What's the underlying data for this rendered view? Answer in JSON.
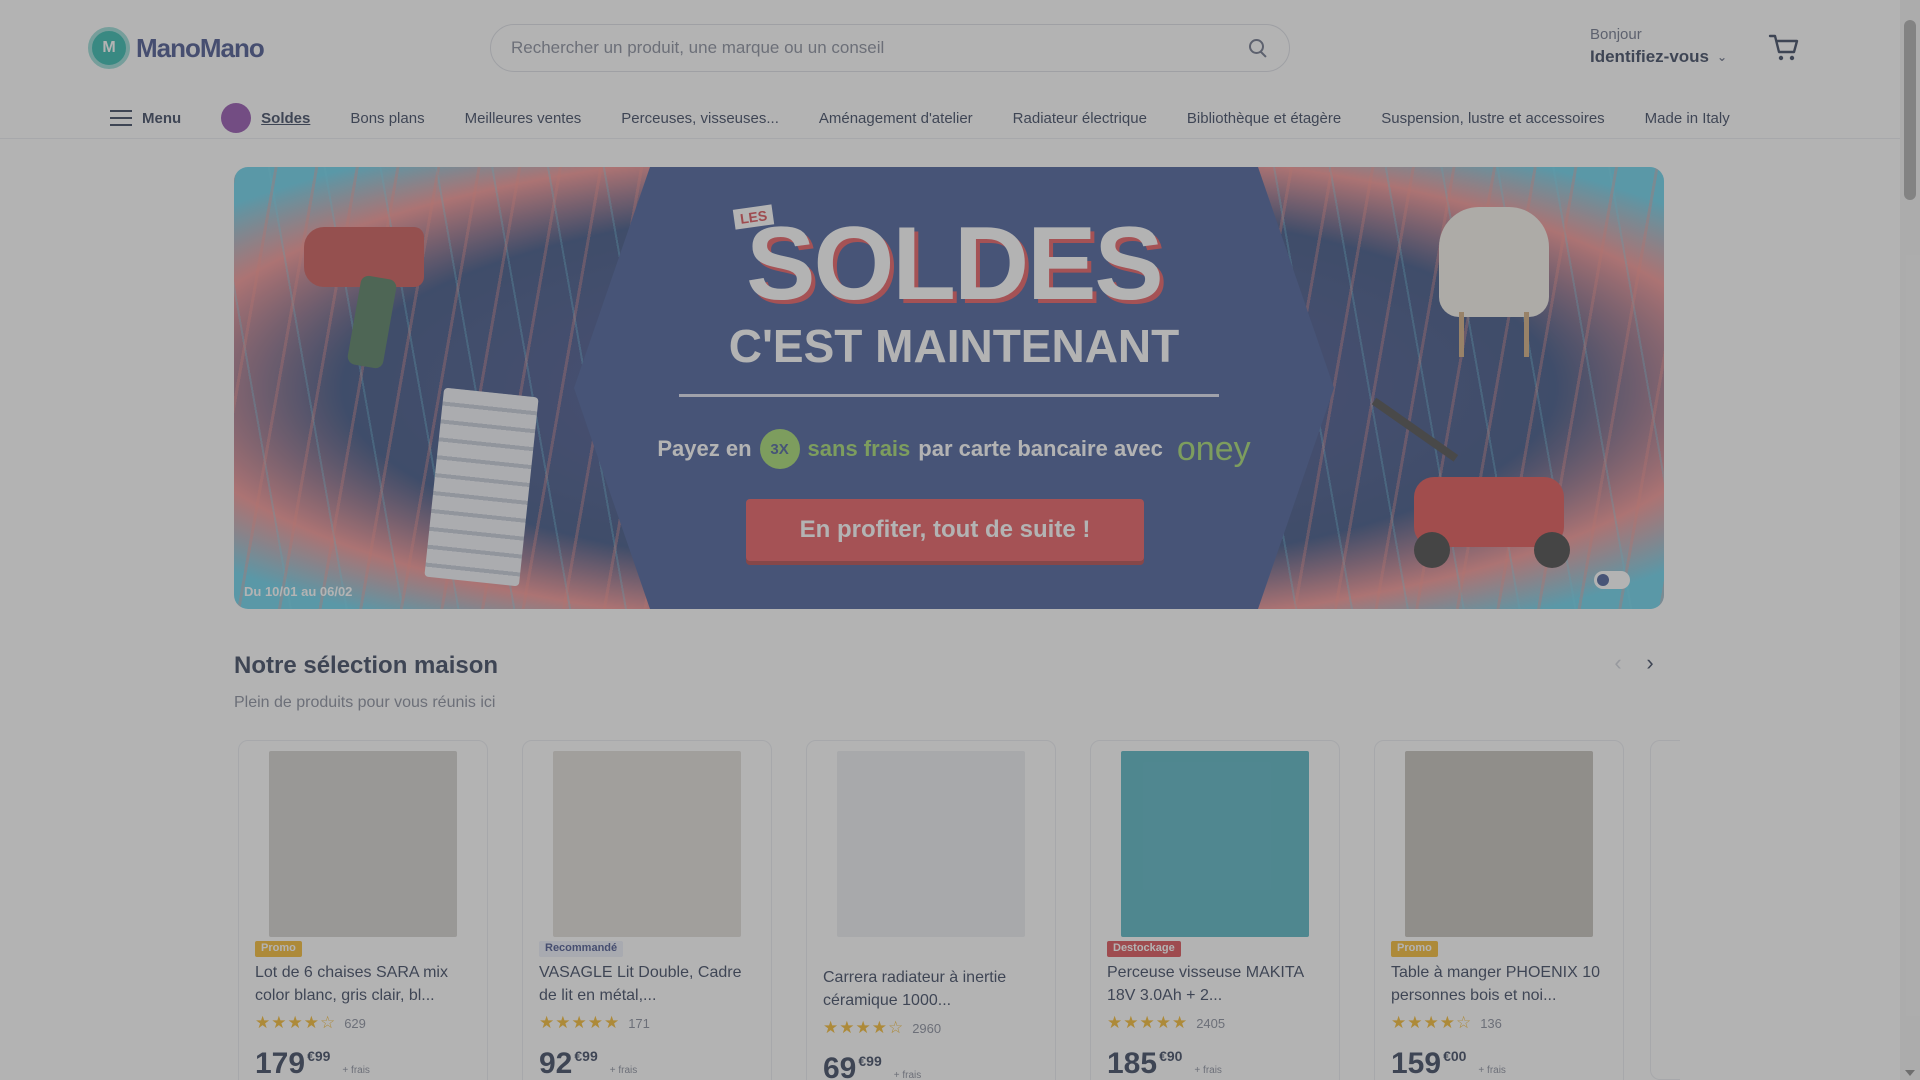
{
  "header": {
    "logo_mark": "M",
    "logo_text": "ManoMano",
    "search_placeholder": "Rechercher un produit, une marque ou un conseil",
    "account_greeting": "Bonjour",
    "account_login": "Identifiez-vous",
    "account_chevron": "⌄"
  },
  "nav": {
    "menu_label": "Menu",
    "soldes_label": "Soldes",
    "items": [
      "Bons plans",
      "Meilleures ventes",
      "Perceuses, visseuses...",
      "Aménagement d'atelier",
      "Radiateur électrique",
      "Bibliothèque et étagère",
      "Suspension, lustre et accessoires",
      "Made in Italy"
    ]
  },
  "hero": {
    "tag": "LES",
    "title": "SOLDES",
    "subtitle": "C'EST MAINTENANT",
    "pay_prefix": "Payez en",
    "pay_badge": "3X",
    "pay_green": "sans frais",
    "pay_suffix": "par carte bancaire avec",
    "pay_brand": "oney",
    "cta": "En profiter, tout de suite !",
    "dates": "Du 10/01 au 06/02"
  },
  "section": {
    "title": "Notre sélection maison",
    "subtitle": "Plein de produits pour vous réunis ici",
    "prev": "‹",
    "next": "›"
  },
  "products": [
    {
      "title": "Lot de 6 chaises SARA mix color blanc, gris clair, bl...",
      "badge": "Promo",
      "rating": "★★★★☆",
      "reviews": "629",
      "price_int": "179",
      "price_dec": "€99",
      "note": "+ frais",
      "image_color": "#c9c7c2"
    },
    {
      "title": "VASAGLE Lit Double, Cadre de lit en métal,...",
      "badge": "Recommandé",
      "rating": "★★★★★",
      "reviews": "171",
      "price_int": "92",
      "price_dec": "€99",
      "note": "+ frais",
      "image_color": "#d9d5cf"
    },
    {
      "title": "Carrera radiateur à inertie céramique 1000...",
      "badge": "",
      "rating": "★★★★☆",
      "reviews": "2960",
      "price_int": "69",
      "price_dec": "€99",
      "note": "+ frais",
      "image_color": "#e8eaee"
    },
    {
      "title": "Perceuse visseuse MAKITA 18V 3.0Ah + 2...",
      "badge": "Destockage",
      "rating": "★★★★★",
      "reviews": "2405",
      "price_int": "185",
      "price_dec": "€90",
      "note": "+ frais",
      "image_color": "#2fa3b5"
    },
    {
      "title": "Table à manger PHOENIX 10 personnes bois et noi...",
      "badge": "Promo",
      "rating": "★★★★☆",
      "reviews": "136",
      "price_int": "159",
      "price_dec": "€00",
      "note": "+ frais",
      "image_color": "#b7b2aa"
    }
  ],
  "colors": {
    "brand_teal": "#00a89a",
    "navy": "#0c193a",
    "cta_red": "#e2363c",
    "star": "#f2a900",
    "badge_red": "#d3262f"
  },
  "icons": {
    "search": "search-icon",
    "cart": "cart-icon",
    "menu": "hamburger-icon"
  }
}
